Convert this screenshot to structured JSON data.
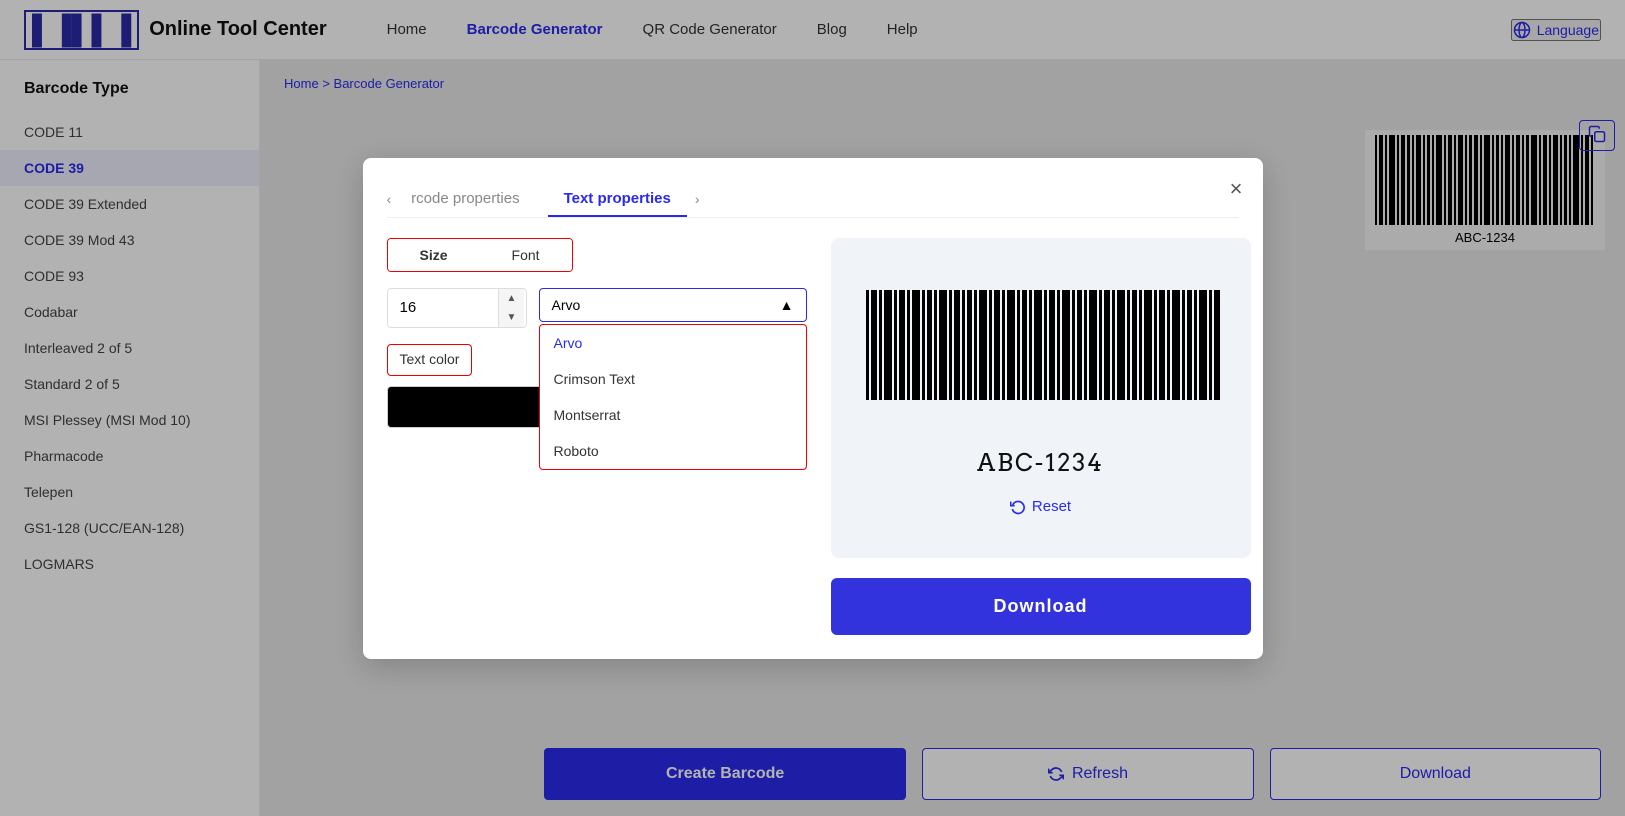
{
  "header": {
    "logo_text": "Online Tool Center",
    "nav_items": [
      {
        "label": "Home",
        "active": false
      },
      {
        "label": "Barcode Generator",
        "active": true
      },
      {
        "label": "QR Code Generator",
        "active": false
      },
      {
        "label": "Blog",
        "active": false
      },
      {
        "label": "Help",
        "active": false
      }
    ],
    "language_label": "Language"
  },
  "sidebar": {
    "title": "Barcode Type",
    "items": [
      {
        "label": "CODE 11",
        "active": false
      },
      {
        "label": "CODE 39",
        "active": true
      },
      {
        "label": "CODE 39 Extended",
        "active": false
      },
      {
        "label": "CODE 39 Mod 43",
        "active": false
      },
      {
        "label": "CODE 93",
        "active": false
      },
      {
        "label": "Codabar",
        "active": false
      },
      {
        "label": "Interleaved 2 of 5",
        "active": false
      },
      {
        "label": "Standard 2 of 5",
        "active": false
      },
      {
        "label": "MSI Plessey (MSI Mod 10)",
        "active": false
      },
      {
        "label": "Pharmacode",
        "active": false
      },
      {
        "label": "Telepen",
        "active": false
      },
      {
        "label": "GS1-128 (UCC/EAN-128)",
        "active": false
      },
      {
        "label": "LOGMARS",
        "active": false
      }
    ]
  },
  "breadcrumb": {
    "home": "Home",
    "separator": ">",
    "current": "Barcode Generator"
  },
  "modal": {
    "prev_tab_label": "rcode properties",
    "active_tab_label": "Text properties",
    "close_label": "×",
    "size_tab": "Size",
    "font_tab": "Font",
    "size_value": "16",
    "selected_font": "Arvo",
    "font_options": [
      {
        "label": "Arvo",
        "active": true
      },
      {
        "label": "Crimson Text",
        "active": false
      },
      {
        "label": "Montserrat",
        "active": false
      },
      {
        "label": "Roboto",
        "active": false
      }
    ],
    "text_color_label": "Text color",
    "color_value": "#000000",
    "barcode_text": "ABC-1234",
    "reset_label": "Reset",
    "download_label": "Download"
  },
  "bottom_bar": {
    "create_label": "Create Barcode",
    "refresh_label": "Refresh",
    "download_label": "Download"
  }
}
